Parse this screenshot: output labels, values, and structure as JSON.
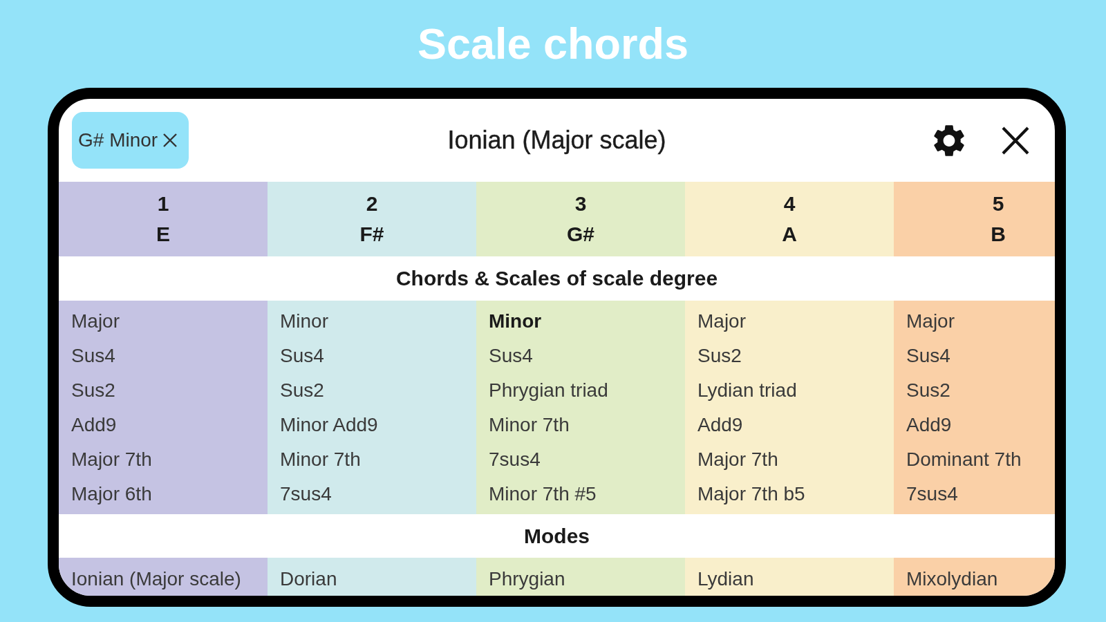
{
  "headline": "Scale chords",
  "toolbar": {
    "key_chip": {
      "label": "G# Minor"
    },
    "title": "Ionian (Major scale)"
  },
  "table": {
    "degrees": [
      {
        "number": "1",
        "note": "E",
        "color": "#c5c3e3"
      },
      {
        "number": "2",
        "note": "F#",
        "color": "#d0eaec"
      },
      {
        "number": "3",
        "note": "G#",
        "color": "#e1edc7"
      },
      {
        "number": "4",
        "note": "A",
        "color": "#f9efcb"
      },
      {
        "number": "5",
        "note": "B",
        "color": "#fad0a7"
      }
    ],
    "chords_section": {
      "heading": "Chords & Scales of scale degree",
      "columns": [
        {
          "chords": [
            {
              "name": "Major",
              "selected": false
            },
            {
              "name": "Sus4",
              "selected": false
            },
            {
              "name": "Sus2",
              "selected": false
            },
            {
              "name": "Add9",
              "selected": false
            },
            {
              "name": "Major 7th",
              "selected": false
            },
            {
              "name": "Major 6th",
              "selected": false
            }
          ]
        },
        {
          "chords": [
            {
              "name": "Minor",
              "selected": false
            },
            {
              "name": "Sus4",
              "selected": false
            },
            {
              "name": "Sus2",
              "selected": false
            },
            {
              "name": "Minor Add9",
              "selected": false
            },
            {
              "name": "Minor 7th",
              "selected": false
            },
            {
              "name": "7sus4",
              "selected": false
            }
          ]
        },
        {
          "chords": [
            {
              "name": "Minor",
              "selected": true
            },
            {
              "name": "Sus4",
              "selected": false
            },
            {
              "name": "Phrygian triad",
              "selected": false
            },
            {
              "name": "Minor 7th",
              "selected": false
            },
            {
              "name": "7sus4",
              "selected": false
            },
            {
              "name": "Minor 7th #5",
              "selected": false
            }
          ]
        },
        {
          "chords": [
            {
              "name": "Major",
              "selected": false
            },
            {
              "name": "Sus2",
              "selected": false
            },
            {
              "name": "Lydian triad",
              "selected": false
            },
            {
              "name": "Add9",
              "selected": false
            },
            {
              "name": "Major 7th",
              "selected": false
            },
            {
              "name": "Major 7th b5",
              "selected": false
            }
          ]
        },
        {
          "chords": [
            {
              "name": "Major",
              "selected": false
            },
            {
              "name": "Sus4",
              "selected": false
            },
            {
              "name": "Sus2",
              "selected": false
            },
            {
              "name": "Add9",
              "selected": false
            },
            {
              "name": "Dominant 7th",
              "selected": false
            },
            {
              "name": "7sus4",
              "selected": false
            }
          ]
        }
      ]
    },
    "modes_section": {
      "heading": "Modes",
      "modes": [
        "Ionian (Major scale)",
        "Dorian",
        "Phrygian",
        "Lydian",
        "Mixolydian"
      ]
    }
  }
}
